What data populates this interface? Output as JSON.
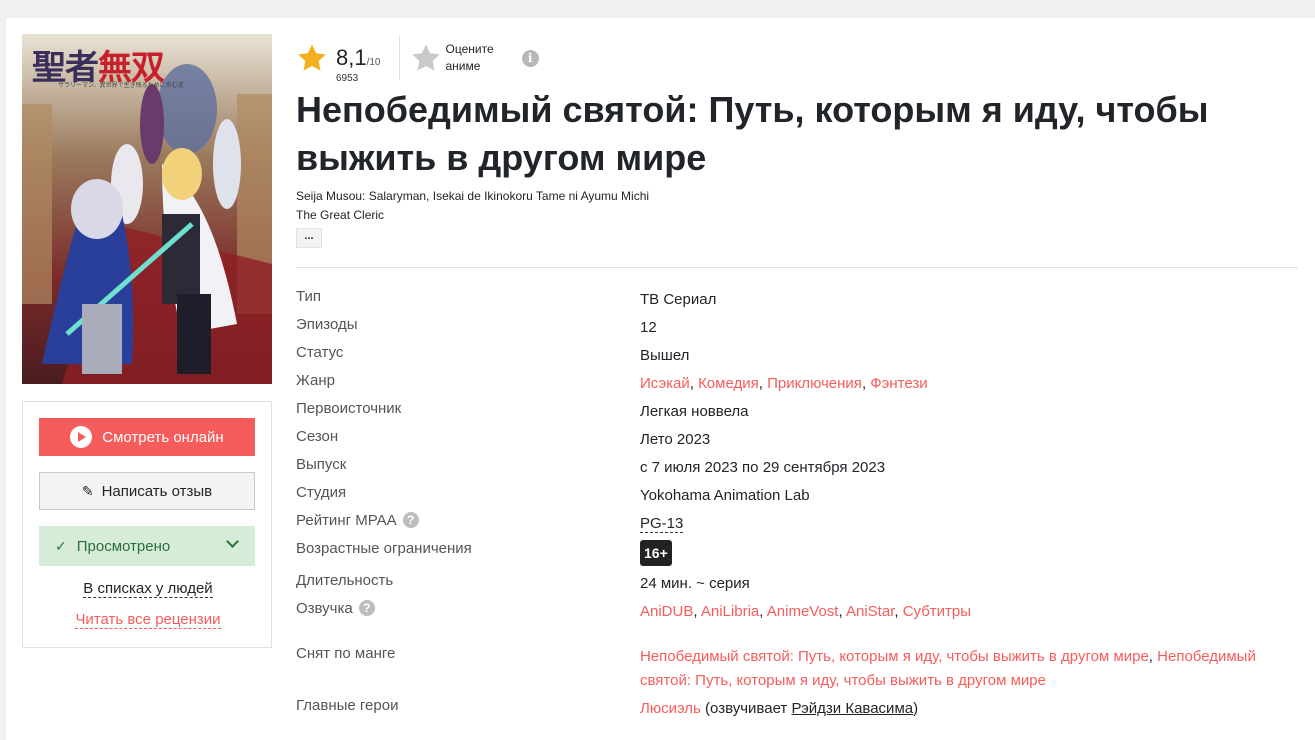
{
  "poster": {
    "title_main": "聖者",
    "title_accent": "無双",
    "subtitle": "サラリーマン、異世界で生き残るために歩む道"
  },
  "actions": {
    "watch_label": "Смотреть онлайн",
    "review_label": "Написать отзыв",
    "watched_label": "Просмотрено",
    "lists_label": "В списках у людей",
    "reviews_label": "Читать все рецензии"
  },
  "rating": {
    "value": "8,1",
    "max": "/10",
    "votes": "6953",
    "rate_line1": "Оцените",
    "rate_line2": "аниме"
  },
  "title": "Непобедимый святой: Путь, которым я иду, чтобы выжить в другом мире",
  "alt_names": [
    "Seija Musou: Salaryman, Isekai de Ikinokoru Tame ni Ayumu Michi",
    "The Great Cleric"
  ],
  "more_label": "...",
  "info": {
    "type": {
      "label": "Тип",
      "value": "ТВ Сериал"
    },
    "episodes": {
      "label": "Эпизоды",
      "value": "12"
    },
    "status": {
      "label": "Статус",
      "value": "Вышел"
    },
    "genre": {
      "label": "Жанр",
      "values": [
        "Исэкай",
        "Комедия",
        "Приключения",
        "Фэнтези"
      ],
      "sep": ", "
    },
    "source": {
      "label": "Первоисточник",
      "value": "Легкая новвела"
    },
    "season": {
      "label": "Сезон",
      "value": "Лето 2023"
    },
    "release": {
      "label": "Выпуск",
      "value": "с 7 июля 2023 по 29 сентября 2023"
    },
    "studio": {
      "label": "Студия",
      "value": "Yokohama Animation Lab"
    },
    "mpaa": {
      "label": "Рейтинг MPAA",
      "value": "PG-13",
      "help": "?"
    },
    "age": {
      "label": "Возрастные ограничения",
      "value": "16+"
    },
    "duration": {
      "label": "Длительность",
      "value": "24 мин. ~ серия"
    },
    "dub": {
      "label": "Озвучка",
      "help": "?",
      "values": [
        "AniDUB",
        "AniLibria",
        "AnimeVost",
        "AniStar",
        "Субтитры"
      ],
      "sep": ", "
    },
    "manga": {
      "label": "Снят по манге",
      "line1": "Непобедимый святой: Путь, которым я иду, чтобы выжить в другом мире",
      "comma": ", ",
      "line1b": "Непобедимый",
      "line2": "святой: Путь, которым я иду, чтобы выжить в другом мире"
    },
    "heroes": {
      "label": "Главные герои",
      "name": "Люсиэль",
      "voiced_prefix": " (озвучивает ",
      "voice": "Рэйдзи Кавасима",
      "voiced_suffix": ")"
    }
  },
  "colors": {
    "accent": "#f75c5c",
    "star": "#f2b01e",
    "watched_bg": "#d6ecd9"
  }
}
